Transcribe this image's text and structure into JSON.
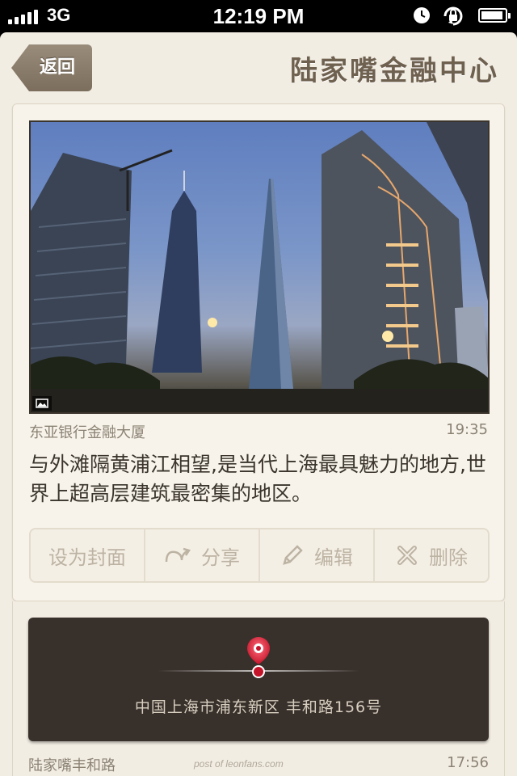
{
  "status_bar": {
    "network": "3G",
    "time": "12:19 PM"
  },
  "nav": {
    "back_label": "返回",
    "title": "陆家嘴金融中心"
  },
  "photo": {
    "location": "东亚银行金融大厦",
    "time": "19:35",
    "description": "与外滩隔黄浦江相望,是当代上海最具魅力的地方,世界上超高层建筑最密集的地区。"
  },
  "actions": {
    "set_cover": "设为封面",
    "share": "分享",
    "edit": "编辑",
    "delete": "删除"
  },
  "map": {
    "address": "中国上海市浦东新区 丰和路156号"
  },
  "next_entry": {
    "title": "陆家嘴丰和路",
    "time": "17:56"
  },
  "watermark": "post of leonfans.com",
  "colors": {
    "background": "#f2ede3",
    "title": "#6f6150",
    "map_panel": "#38302b",
    "pin": "#e0283a"
  }
}
